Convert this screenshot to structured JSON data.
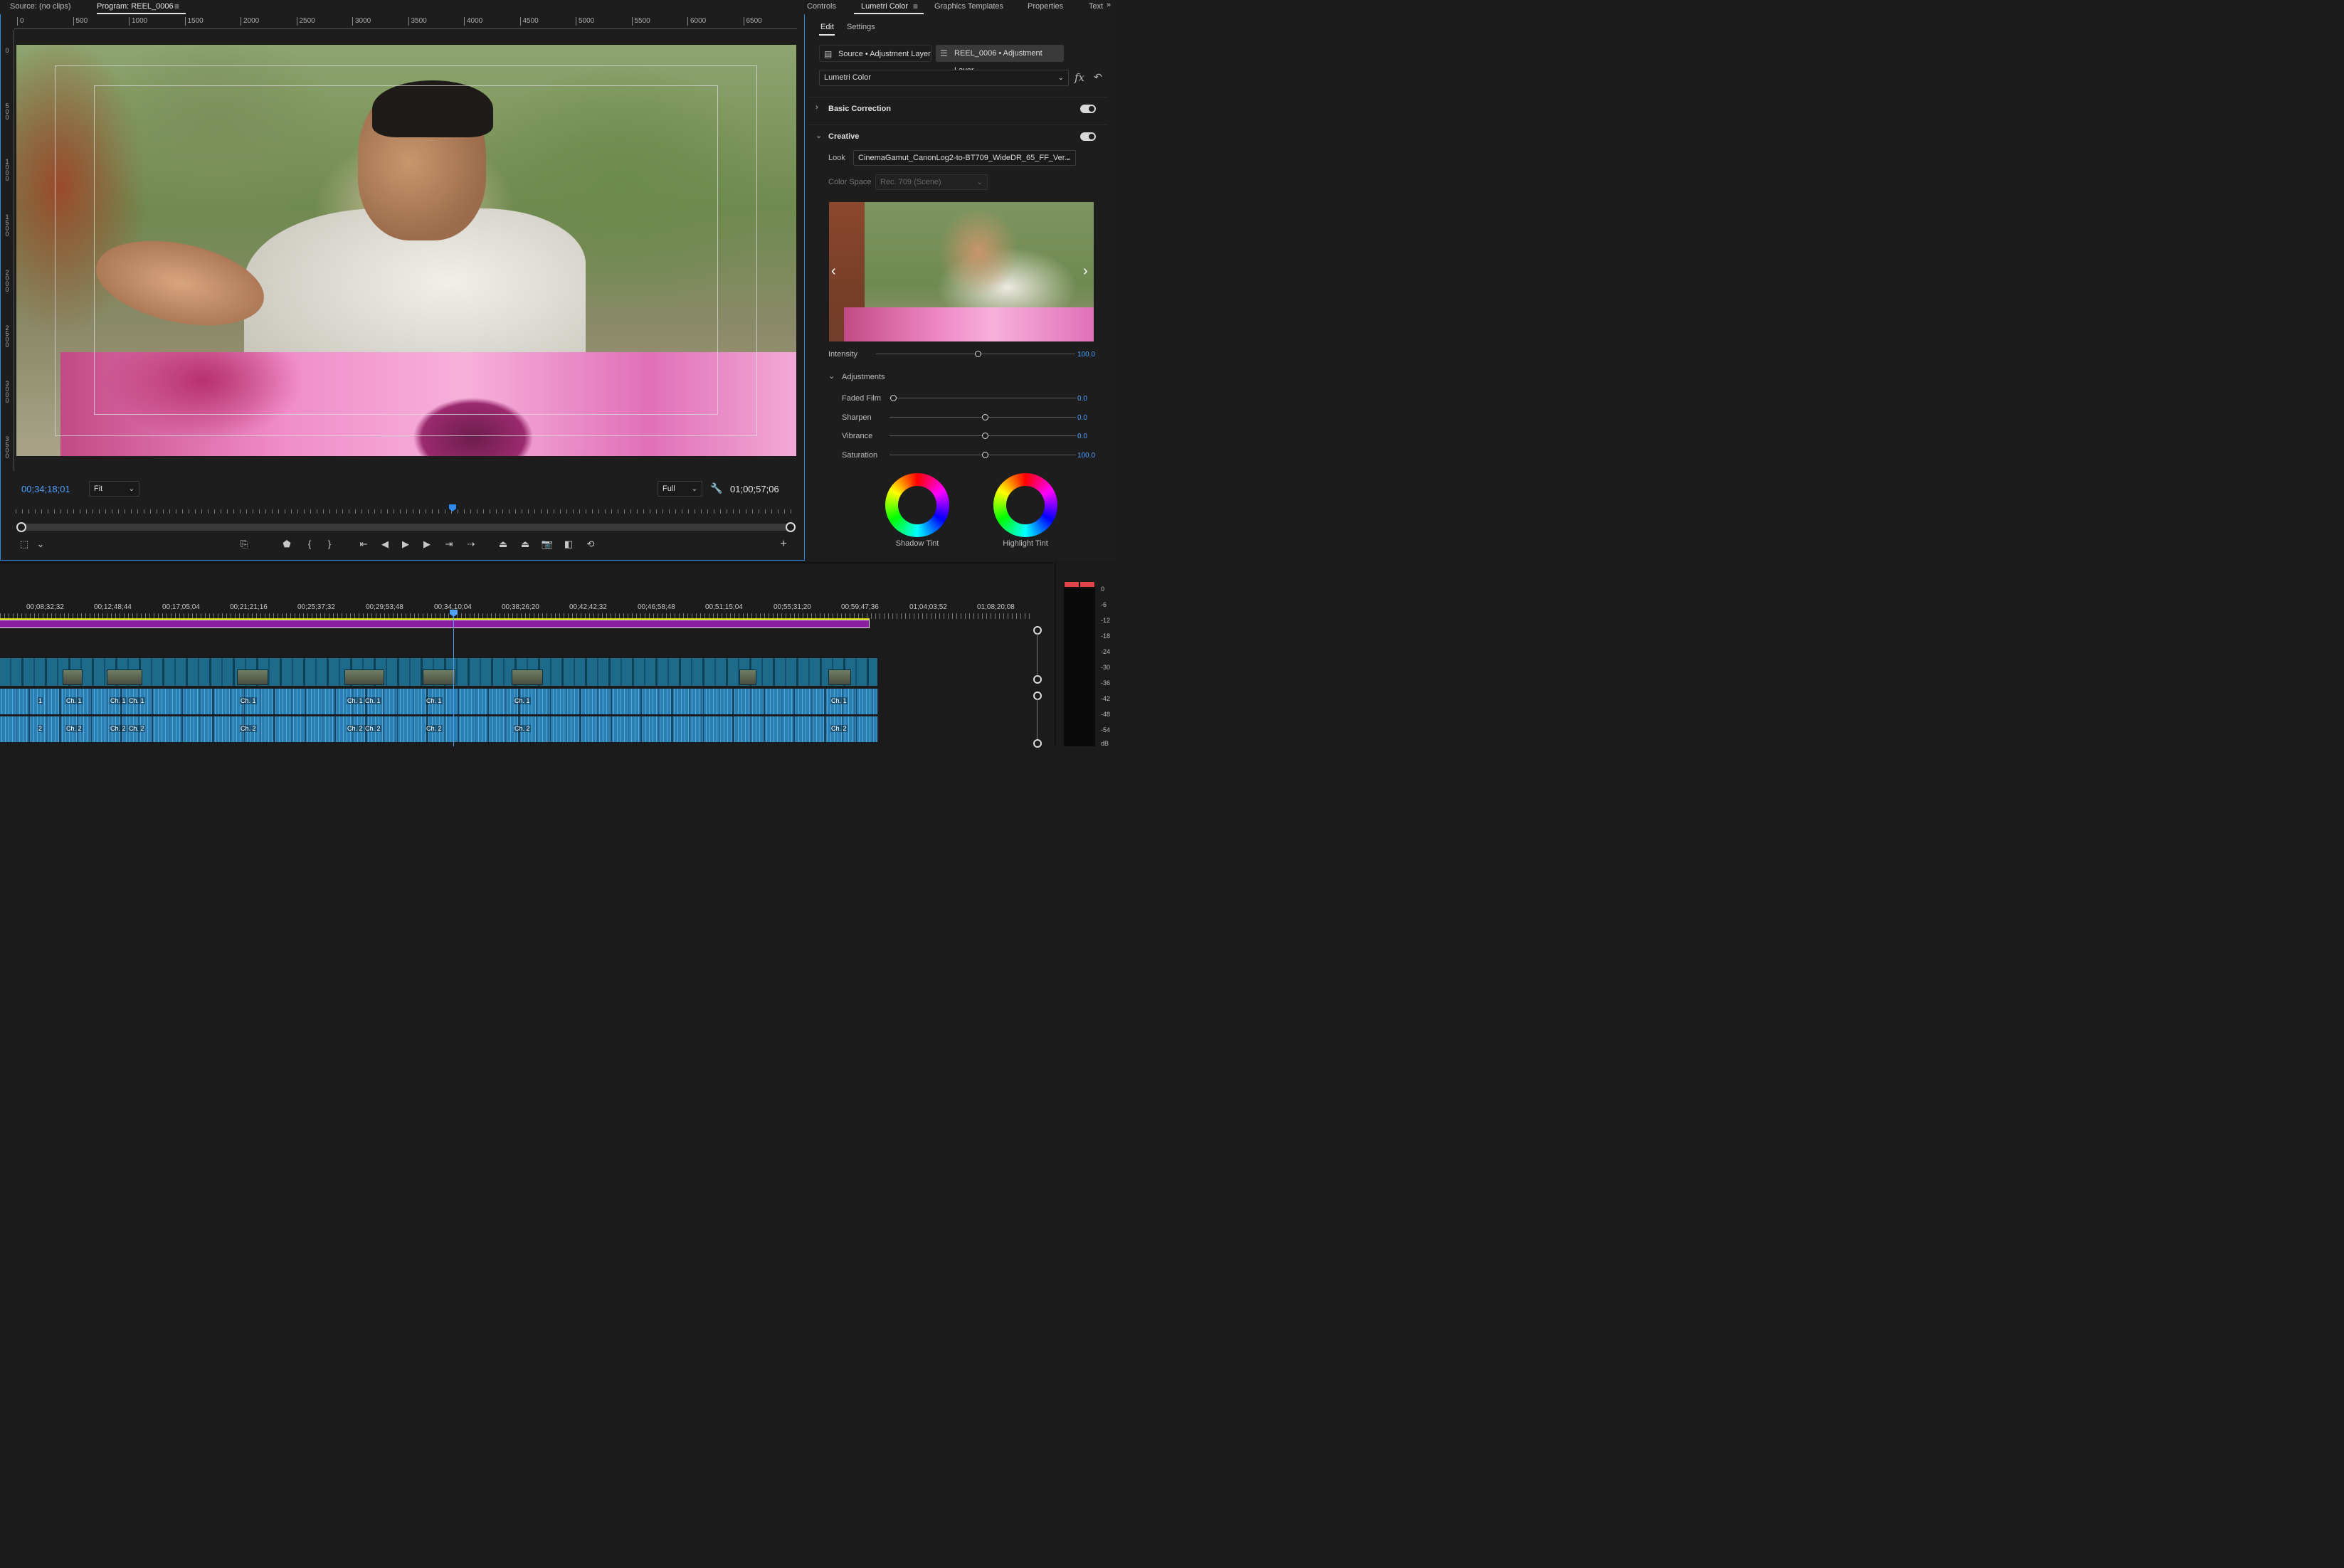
{
  "monitor": {
    "source_tab": "Source: (no clips)",
    "program_tab": "Program: REEL_0006",
    "ruler_labels": [
      "0",
      "500",
      "1000",
      "1500",
      "2000",
      "2500",
      "3000",
      "3500",
      "4000",
      "4500",
      "5000",
      "5500",
      "6000",
      "6500"
    ],
    "vruler_labels": [
      "0",
      "500",
      "1000",
      "1500",
      "2000",
      "2500",
      "3000",
      "3500"
    ],
    "timecode_current": "00;34;18;01",
    "timecode_duration": "01;00;57;06",
    "zoom_select": "Fit",
    "resolution_select": "Full",
    "playhead_fraction": 0.558,
    "accent_color": "#2d8ceb"
  },
  "transport_icons": [
    "safe-margins-icon",
    "chevron-down-icon",
    "multicam-icon",
    "add-marker-icon",
    "mark-in-icon",
    "mark-out-icon",
    "go-to-in-icon",
    "step-back-icon",
    "play-icon",
    "step-forward-icon",
    "go-to-out-icon",
    "insert-icon",
    "overwrite-icon",
    "lift-icon",
    "extract-icon",
    "export-frame-icon",
    "comparison-view-icon",
    "proxy-icon",
    "add-button-icon"
  ],
  "lumetri": {
    "tabs": [
      "Controls",
      "Lumetri Color",
      "Graphics Templates",
      "Properties",
      "Text"
    ],
    "subtabs": [
      "Edit",
      "Settings"
    ],
    "source_layer": "Source • Adjustment Layer",
    "reel_layer": "REEL_0006 • Adjustment Layer",
    "effect": "Lumetri Color",
    "sections": {
      "basic": "Basic Correction",
      "creative": "Creative",
      "adjustments": "Adjustments"
    },
    "look_label": "Look",
    "look_value": "CinemaGamut_CanonLog2-to-BT709_WideDR_65_FF_Ver...",
    "colorspace_label": "Color Space",
    "colorspace_value": "Rec. 709 (Scene)",
    "intensity": {
      "label": "Intensity",
      "value": "100.0",
      "fraction": 1.0
    },
    "sliders": [
      {
        "label": "Faded Film",
        "value": "0.0",
        "fraction": 0.0
      },
      {
        "label": "Sharpen",
        "value": "0.0",
        "fraction": 0.5
      },
      {
        "label": "Vibrance",
        "value": "0.0",
        "fraction": 0.5
      },
      {
        "label": "Saturation",
        "value": "100.0",
        "fraction": 0.5
      }
    ],
    "wheels": [
      "Shadow Tint",
      "Highlight Tint"
    ]
  },
  "timeline": {
    "timecodes": [
      "00;08;32;32",
      "00;12;48;44",
      "00;17;05;04",
      "00;21;21;16",
      "00;25;37;32",
      "00;29;53;48",
      "00;34;10;04",
      "00;38;26;20",
      "00;42;42;32",
      "00;46;58;48",
      "00;51;15;04",
      "00;55;31;20",
      "00;59;47;36",
      "01;04;03;52",
      "01;08;20;08"
    ],
    "ch1_label": "Ch. 1",
    "ch2_label": "Ch. 2",
    "ch1_short": "1",
    "ch2_short": "2",
    "work_area_color": "#8a1fa0"
  },
  "meter": {
    "db_labels": [
      "0",
      "-6",
      "-12",
      "-18",
      "-24",
      "-30",
      "-36",
      "-42",
      "-48",
      "-54",
      "dB"
    ],
    "peak_color": "#e04545"
  }
}
